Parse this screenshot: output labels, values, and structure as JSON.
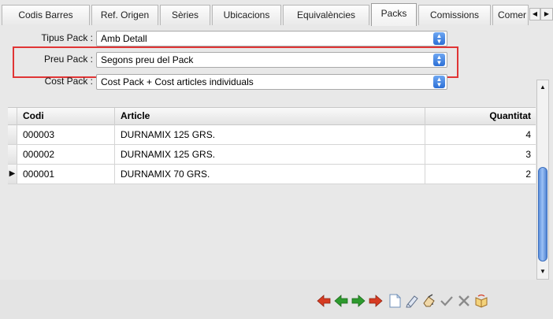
{
  "tabs": [
    {
      "label": "Codis Barres"
    },
    {
      "label": "Ref. Origen"
    },
    {
      "label": "Sèries"
    },
    {
      "label": "Ubicacions"
    },
    {
      "label": "Equivalències"
    },
    {
      "label": "Packs"
    },
    {
      "label": "Comissions"
    },
    {
      "label": "Comer"
    }
  ],
  "active_tab": "Packs",
  "form": {
    "tipus_pack": {
      "label": "Tipus Pack :",
      "value": "Amb Detall"
    },
    "preu_pack": {
      "label": "Preu Pack :",
      "value": "Segons preu del Pack"
    },
    "cost_pack": {
      "label": "Cost Pack :",
      "value": "Cost Pack + Cost articles individuals"
    }
  },
  "grid": {
    "columns": [
      "Codi",
      "Article",
      "Quantitat"
    ],
    "rows": [
      {
        "codi": "000003",
        "article": "DURNAMIX 125 GRS.",
        "quantitat": "4"
      },
      {
        "codi": "000002",
        "article": "DURNAMIX 125 GRS.",
        "quantitat": "3"
      },
      {
        "codi": "000001",
        "article": "DURNAMIX 70 GRS.",
        "quantitat": "2"
      }
    ],
    "current_row_marker": "▶"
  },
  "toolbar": {
    "icons": [
      "first-icon",
      "prior-icon",
      "next-icon",
      "last-icon",
      "new-icon",
      "edit-icon",
      "delete-icon",
      "post-icon",
      "cancel-icon",
      "refresh-icon"
    ]
  },
  "colors": {
    "highlight": "#e03535",
    "nav_red": "#d63b22",
    "nav_green": "#2e9a2e",
    "scroll_thumb": "#5b8fdc"
  }
}
